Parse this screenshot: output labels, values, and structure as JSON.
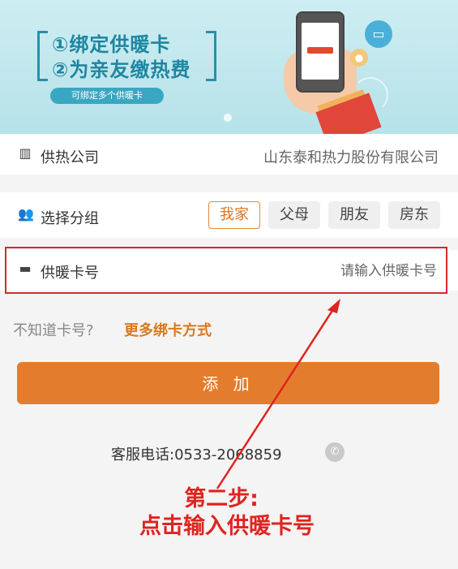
{
  "banner": {
    "line1": "①绑定供暖卡",
    "line2": "②为亲友缴热费",
    "pill": "可绑定多个供暖卡"
  },
  "company": {
    "label": "供热公司",
    "value": "山东泰和热力股份有限公司",
    "icon": "building-icon"
  },
  "group": {
    "label": "选择分组",
    "icon": "people-icon",
    "options": [
      "我家",
      "父母",
      "朋友",
      "房东"
    ],
    "selected": "我家"
  },
  "card": {
    "label": "供暖卡号",
    "icon": "card-icon",
    "placeholder": "请输入供暖卡号"
  },
  "help": {
    "question": "不知道卡号?",
    "link": "更多绑卡方式"
  },
  "add_button": "添 加",
  "service": {
    "text": "客服电话:0533-2068859",
    "icon": "phone-icon"
  },
  "annotation": {
    "line1": "第二步:",
    "line2": "点击输入供暖卡号"
  },
  "colors": {
    "accent": "#e37d2d",
    "annotation": "#e0231f",
    "banner_text": "#1f86a2"
  }
}
